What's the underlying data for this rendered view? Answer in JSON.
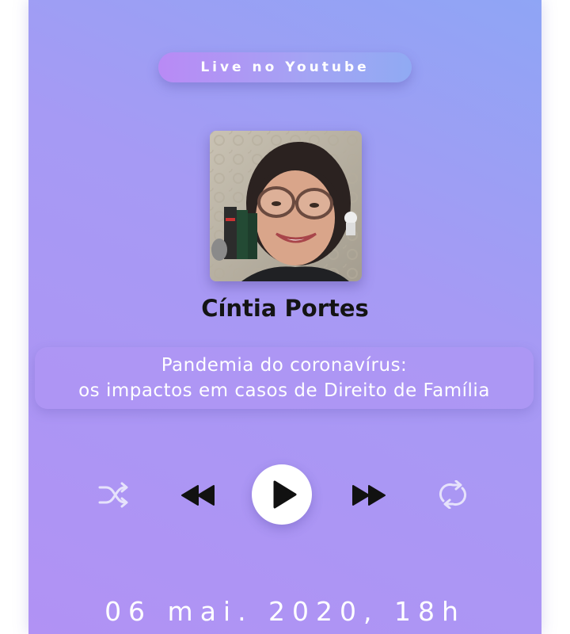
{
  "header": {
    "live_label": "Live no Youtube"
  },
  "speaker": {
    "name": "Cíntia Portes"
  },
  "topic": {
    "line1": "Pandemia do coronavírus:",
    "line2": "os impactos em casos de Direito de Família"
  },
  "controls": {
    "shuffle_icon": "shuffle-icon",
    "rewind_icon": "rewind-icon",
    "play_icon": "play-icon",
    "fast_forward_icon": "fast-forward-icon",
    "repeat_icon": "repeat-icon"
  },
  "event": {
    "date": "06 mai. 2020, 18h"
  },
  "colors": {
    "gradient_top": "#8fa5f5",
    "gradient_bottom": "#b192f4",
    "pill_left": "#b98af5",
    "pill_right": "#90aaf3",
    "name_text": "#141414",
    "icon_dark": "#111111",
    "icon_light": "#e6e2fb"
  }
}
